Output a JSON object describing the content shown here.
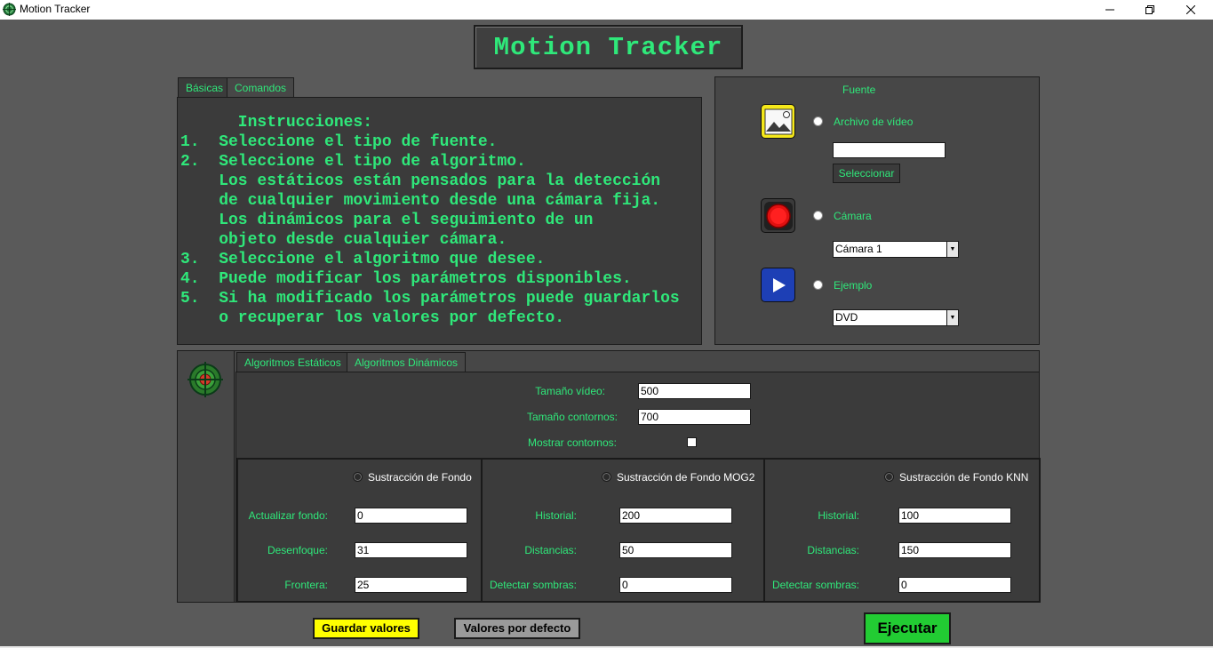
{
  "window": {
    "title": "Motion Tracker",
    "controls": [
      "minimize-icon",
      "restore-icon",
      "close-icon"
    ]
  },
  "header": {
    "title": "Motion Tracker"
  },
  "info_tabs": [
    {
      "label": "Básicas",
      "active": true
    },
    {
      "label": "Comandos",
      "active": false
    }
  ],
  "instructions": {
    "heading": "      Instrucciones:",
    "lines": [
      "1.  Seleccione el tipo de fuente.",
      "2.  Seleccione el tipo de algoritmo.",
      "    Los estáticos están pensados para la detección",
      "    de cualquier movimiento desde una cámara fija.",
      "    Los dinámicos para el seguimiento de un",
      "    objeto desde cualquier cámara.",
      "3.  Seleccione el algoritmo que desee.",
      "4.  Puede modificar los parámetros disponibles.",
      "5.  Si ha modificado los parámetros puede guardarlos",
      "    o recuperar los valores por defecto."
    ]
  },
  "source": {
    "title": "Fuente",
    "video_file": {
      "label": "Archivo de vídeo",
      "value": "",
      "button": "Seleccionar",
      "icon": "image-icon"
    },
    "camera": {
      "label": "Cámara",
      "selected": "Cámara 1",
      "icon": "record-icon"
    },
    "example": {
      "label": "Ejemplo",
      "selected": "DVD",
      "icon": "play-icon"
    }
  },
  "algo_tabs": [
    {
      "label": "Algoritmos Estáticos",
      "active": true
    },
    {
      "label": "Algoritmos Dinámicos",
      "active": false
    }
  ],
  "general_params": {
    "video_size": {
      "label": "Tamaño vídeo:",
      "value": "500"
    },
    "contour_size": {
      "label": "Tamaño contornos:",
      "value": "700"
    },
    "show_contours": {
      "label": "Mostrar contornos:",
      "checked": false
    }
  },
  "algorithms": {
    "bg_sub": {
      "label": "Sustracción de Fondo",
      "params": [
        {
          "label": "Actualizar fondo:",
          "value": "0"
        },
        {
          "label": "Desenfoque:",
          "value": "31"
        },
        {
          "label": "Frontera:",
          "value": "25"
        }
      ]
    },
    "mog2": {
      "label": "Sustracción de Fondo MOG2",
      "params": [
        {
          "label": "Historial:",
          "value": "200"
        },
        {
          "label": "Distancias:",
          "value": "50"
        },
        {
          "label": "Detectar sombras:",
          "value": "0"
        }
      ]
    },
    "knn": {
      "label": "Sustracción de Fondo KNN",
      "params": [
        {
          "label": "Historial:",
          "value": "100"
        },
        {
          "label": "Distancias:",
          "value": "150"
        },
        {
          "label": "Detectar sombras:",
          "value": "0"
        }
      ]
    }
  },
  "actions": {
    "save": "Guardar valores",
    "defaults": "Valores por defecto",
    "run": "Ejecutar"
  },
  "colors": {
    "accent": "#2fe87a",
    "background": "#5a5a5a",
    "panel": "#3b3b3b",
    "save_button": "#ffff00",
    "run_button": "#22cc33"
  }
}
